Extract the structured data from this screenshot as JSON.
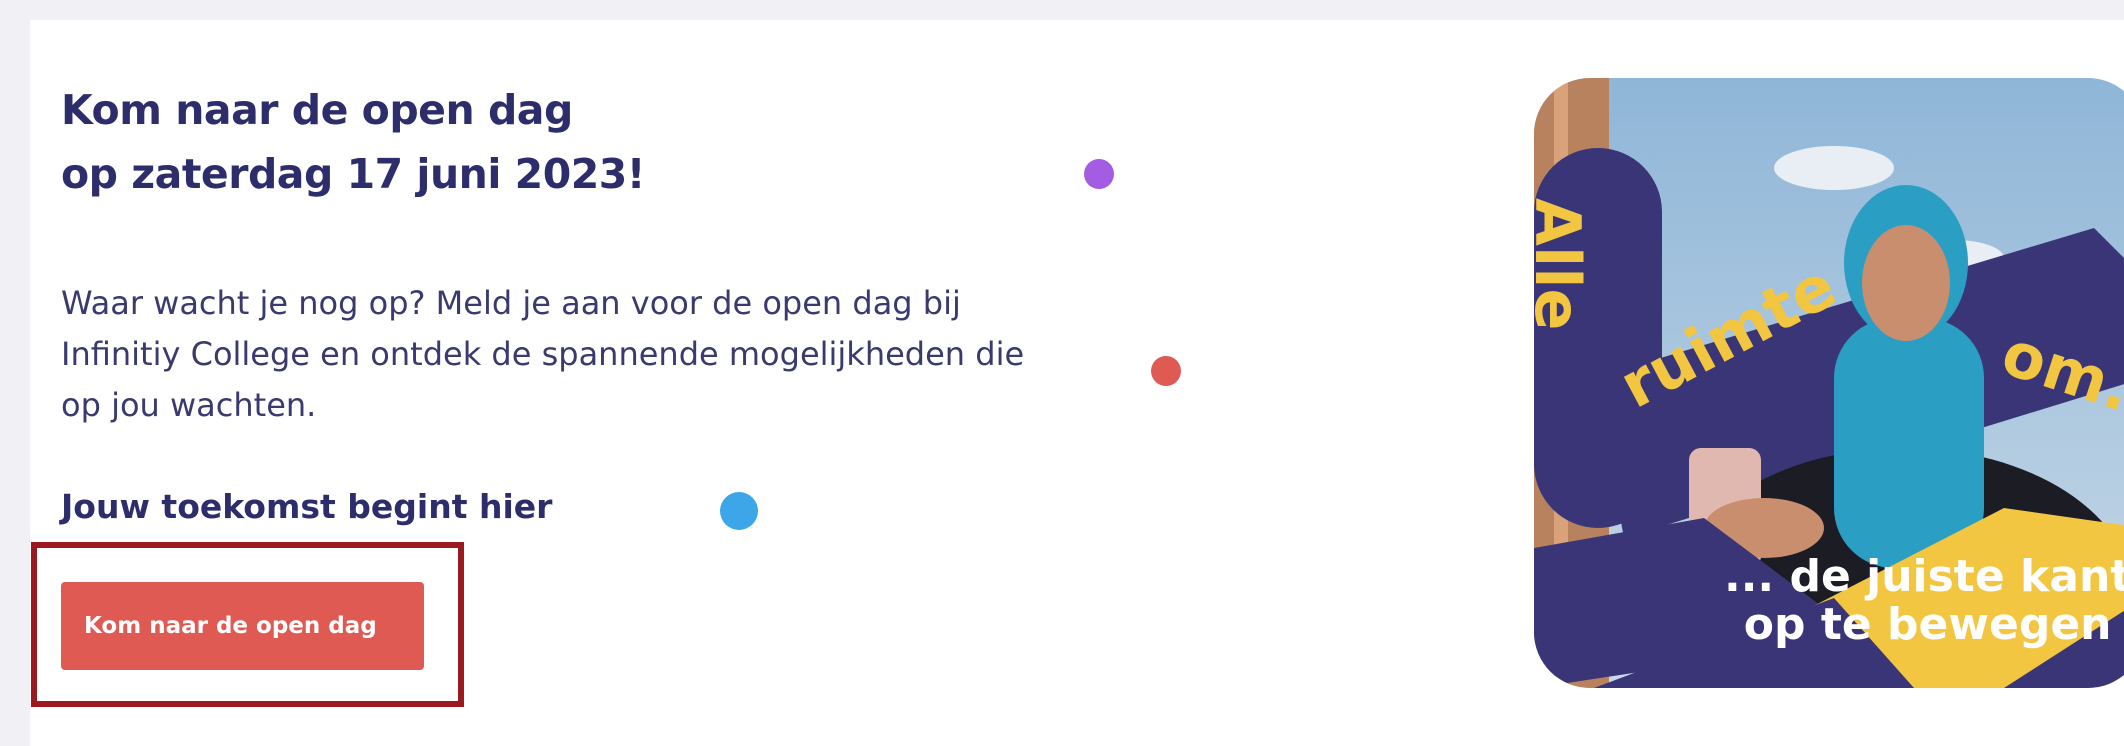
{
  "hero": {
    "title_line1": "Kom naar de open dag",
    "title_line2": "op zaterdag 17 juni 2023!",
    "intro": "Waar wacht je nog op? Meld je aan voor de open dag bij Infinitiy College en ontdek de spannende mogelijkheden die op jou wachten.",
    "subheading": "Jouw toekomst begint hier",
    "cta_label": "Kom naar de open dag"
  },
  "promo_image": {
    "text_top_left": "Alle",
    "text_middle": "ruimte",
    "text_right": "om...",
    "text_bottom_line1": "... de juiste kant",
    "text_bottom_line2": "op te bewegen"
  },
  "colors": {
    "heading": "#2e2d6b",
    "cta_background": "#e05a54",
    "focus_outline": "#9a1a1f",
    "dot_purple": "#a45ce3",
    "dot_red": "#e05a54",
    "dot_blue": "#3ca6e8",
    "promo_navy": "#3a3577",
    "promo_yellow": "#f2c640"
  }
}
